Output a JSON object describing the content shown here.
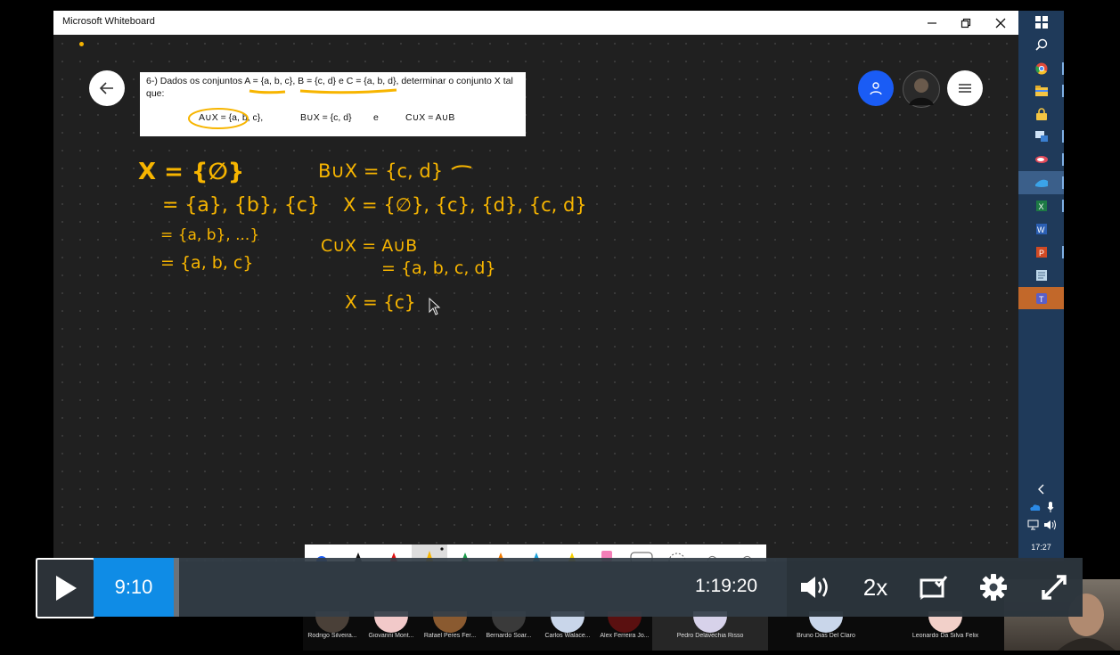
{
  "window": {
    "title": "Microsoft Whiteboard"
  },
  "problem": {
    "statement": "6-) Dados os conjuntos A = {a, b, c}, B = {c, d} e C = {a, b, d}, determinar o conjunto X tal que:",
    "eq1": "A∪X = {a, b, c},",
    "eq2": "B∪X = {c, d}",
    "conj": "e",
    "eq3": "C∪X = A∪B"
  },
  "ink": {
    "left": [
      "X = {∅}",
      "= {a}, {b}, {c}",
      "= {a, b}, ...}",
      "= {a, b, c}"
    ],
    "right": [
      "B∪X = {c, d}",
      "X = {∅}, {c}, {d}, {c, d}",
      "C∪X = A∪B",
      "= {a, b, c, d}",
      "X = {c}"
    ]
  },
  "taskbar": {
    "clock": "17:27"
  },
  "player": {
    "current_time": "9:10",
    "duration": "1:19:20",
    "speed": "2x"
  },
  "participants": [
    {
      "name": "Rodrigo Silveira..."
    },
    {
      "name": "Giovanni Mont..."
    },
    {
      "name": "Rafael Peres Fer..."
    },
    {
      "name": "Bernardo Soar..."
    },
    {
      "name": "Carlos Walace..."
    },
    {
      "name": "Alex Ferreira Jo..."
    },
    {
      "name": "Pedro Delavechia Risso"
    },
    {
      "name": "Bruno Dias Del Claro"
    },
    {
      "name": "Leonardo Da Silva Felix"
    }
  ],
  "colors": {
    "ink": "#f7b500",
    "progress": "#0f8ce6",
    "accent_user": "#1a5cf5",
    "taskbar": "#1f3a5a"
  }
}
